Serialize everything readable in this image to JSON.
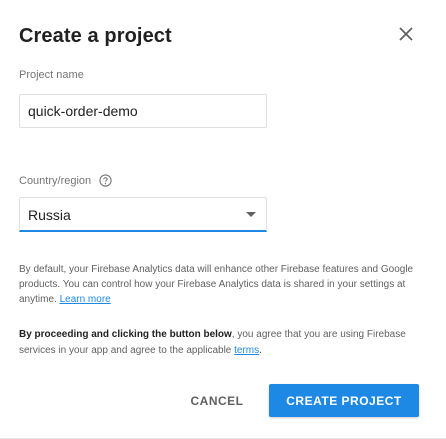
{
  "dialog": {
    "title": "Create a project",
    "close_icon": "close-icon"
  },
  "project_name": {
    "label": "Project name",
    "value": "quick-order-demo"
  },
  "country": {
    "label": "Country/region",
    "help_icon": "help-circle-icon",
    "selected": "Russia",
    "dropdown_icon": "dropdown-arrow-icon"
  },
  "info": {
    "text": "By default, your Firebase Analytics data will enhance other Firebase features and Google products. You can control how your Firebase Analytics data is shared in your settings at anytime.",
    "link": "Learn more"
  },
  "agreement": {
    "bold": "By proceeding and clicking the button below",
    "text": ", you agree that you are using Firebase services in your app and agree to the applicable ",
    "link": "terms",
    "end": "."
  },
  "actions": {
    "cancel": "CANCEL",
    "create": "CREATE PROJECT"
  },
  "colors": {
    "accent": "#1e88e5",
    "text": "#212121",
    "muted": "#757575"
  }
}
